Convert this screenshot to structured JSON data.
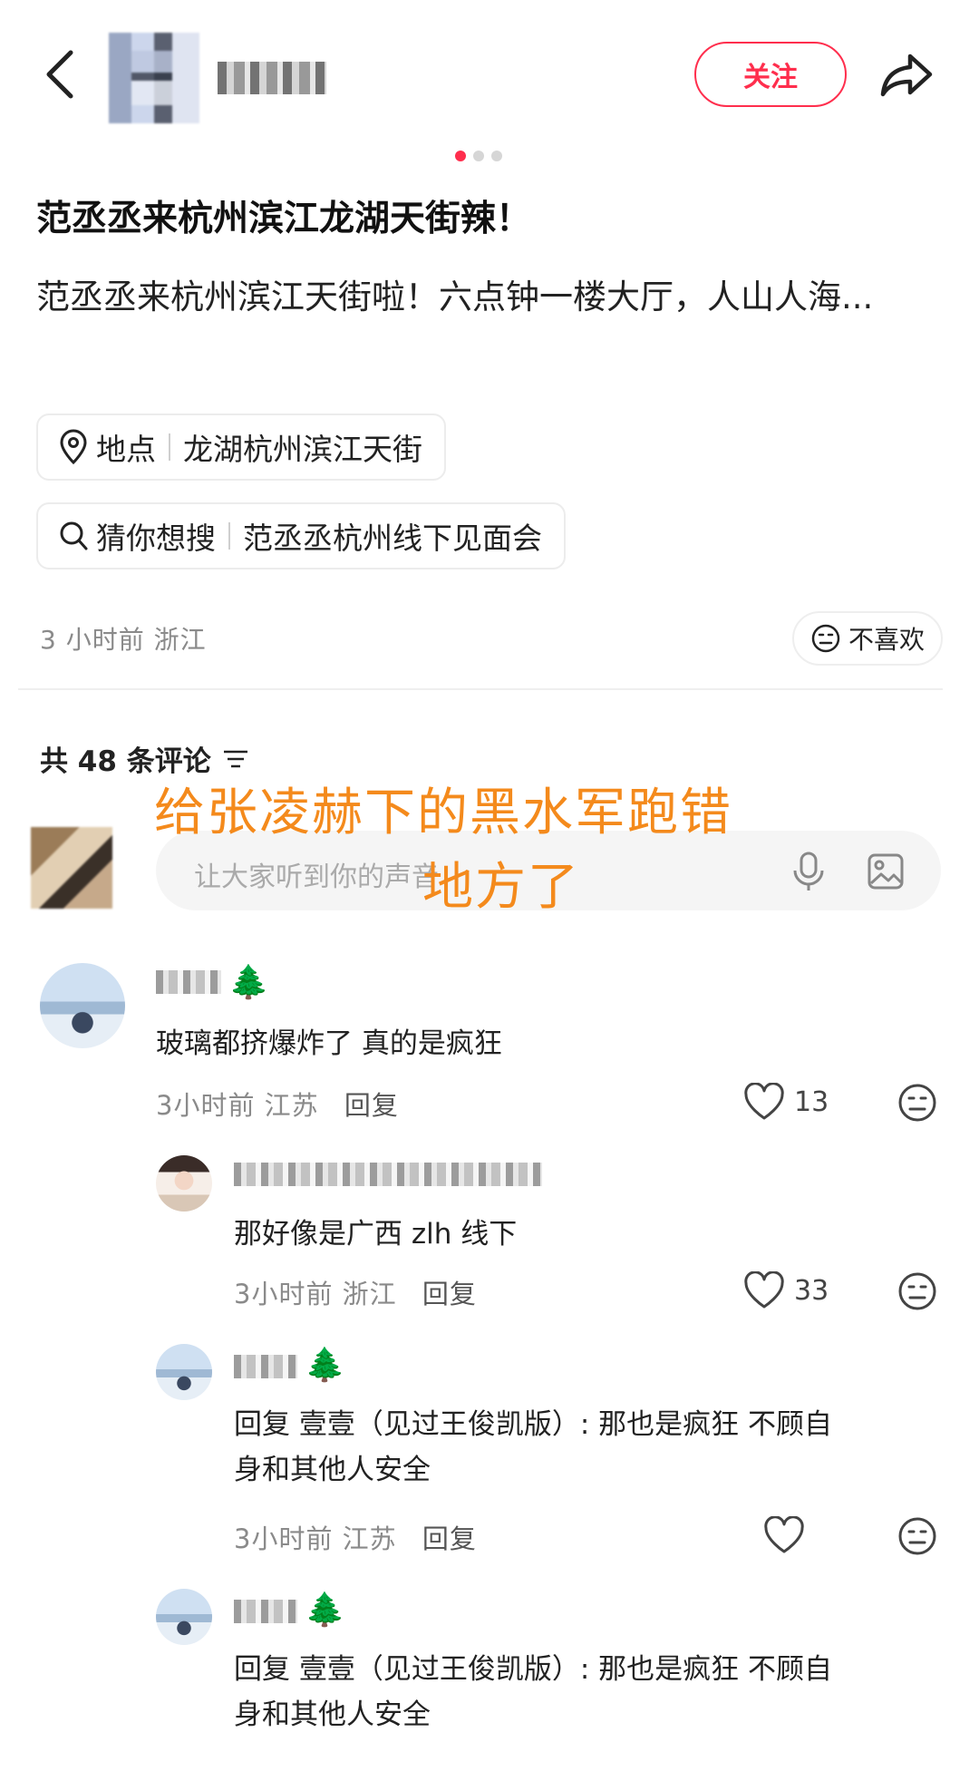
{
  "header": {
    "follow_label": "关注",
    "carousel_total": 3,
    "carousel_active": 1
  },
  "post": {
    "title": "范丞丞来杭州滨江龙湖天街辣！",
    "body": "范丞丞来杭州滨江天街啦！六点钟一楼大厅，人山人海...",
    "location_label": "地点",
    "location_value": "龙湖杭州滨江天街",
    "search_label": "猜你想搜",
    "search_value": "范丞丞杭州线下见面会",
    "meta": "3 小时前  浙江",
    "dislike_label": "不喜欢"
  },
  "comments_header": {
    "count_text": "共 48 条评论",
    "input_placeholder": "让大家听到你的声音"
  },
  "overlay": {
    "line1": "给张凌赫下的黑水军跑错",
    "line2": "地方了"
  },
  "comments": [
    {
      "text": "玻璃都挤爆炸了 真的是疯狂",
      "meta": "3小时前  江苏",
      "reply_label": "回复",
      "likes": "13"
    },
    {
      "text": "那好像是广西 zlh 线下",
      "meta": "3小时前  浙江",
      "reply_label": "回复",
      "likes": "33"
    },
    {
      "text_line1": "回复 壹壹（见过王俊凯版）: 那也是疯狂 不顾自",
      "text_line2": "身和其他人安全",
      "meta": "3小时前  江苏",
      "reply_label": "回复",
      "likes": ""
    },
    {
      "text_line1": "回复 壹壹（见过王俊凯版）: 那也是疯狂 不顾自",
      "text_line2": "身和其他人安全"
    }
  ],
  "colors": {
    "accent": "#ff2e4d",
    "overlay_text": "#f48a1c",
    "muted": "#8a8a8a"
  }
}
